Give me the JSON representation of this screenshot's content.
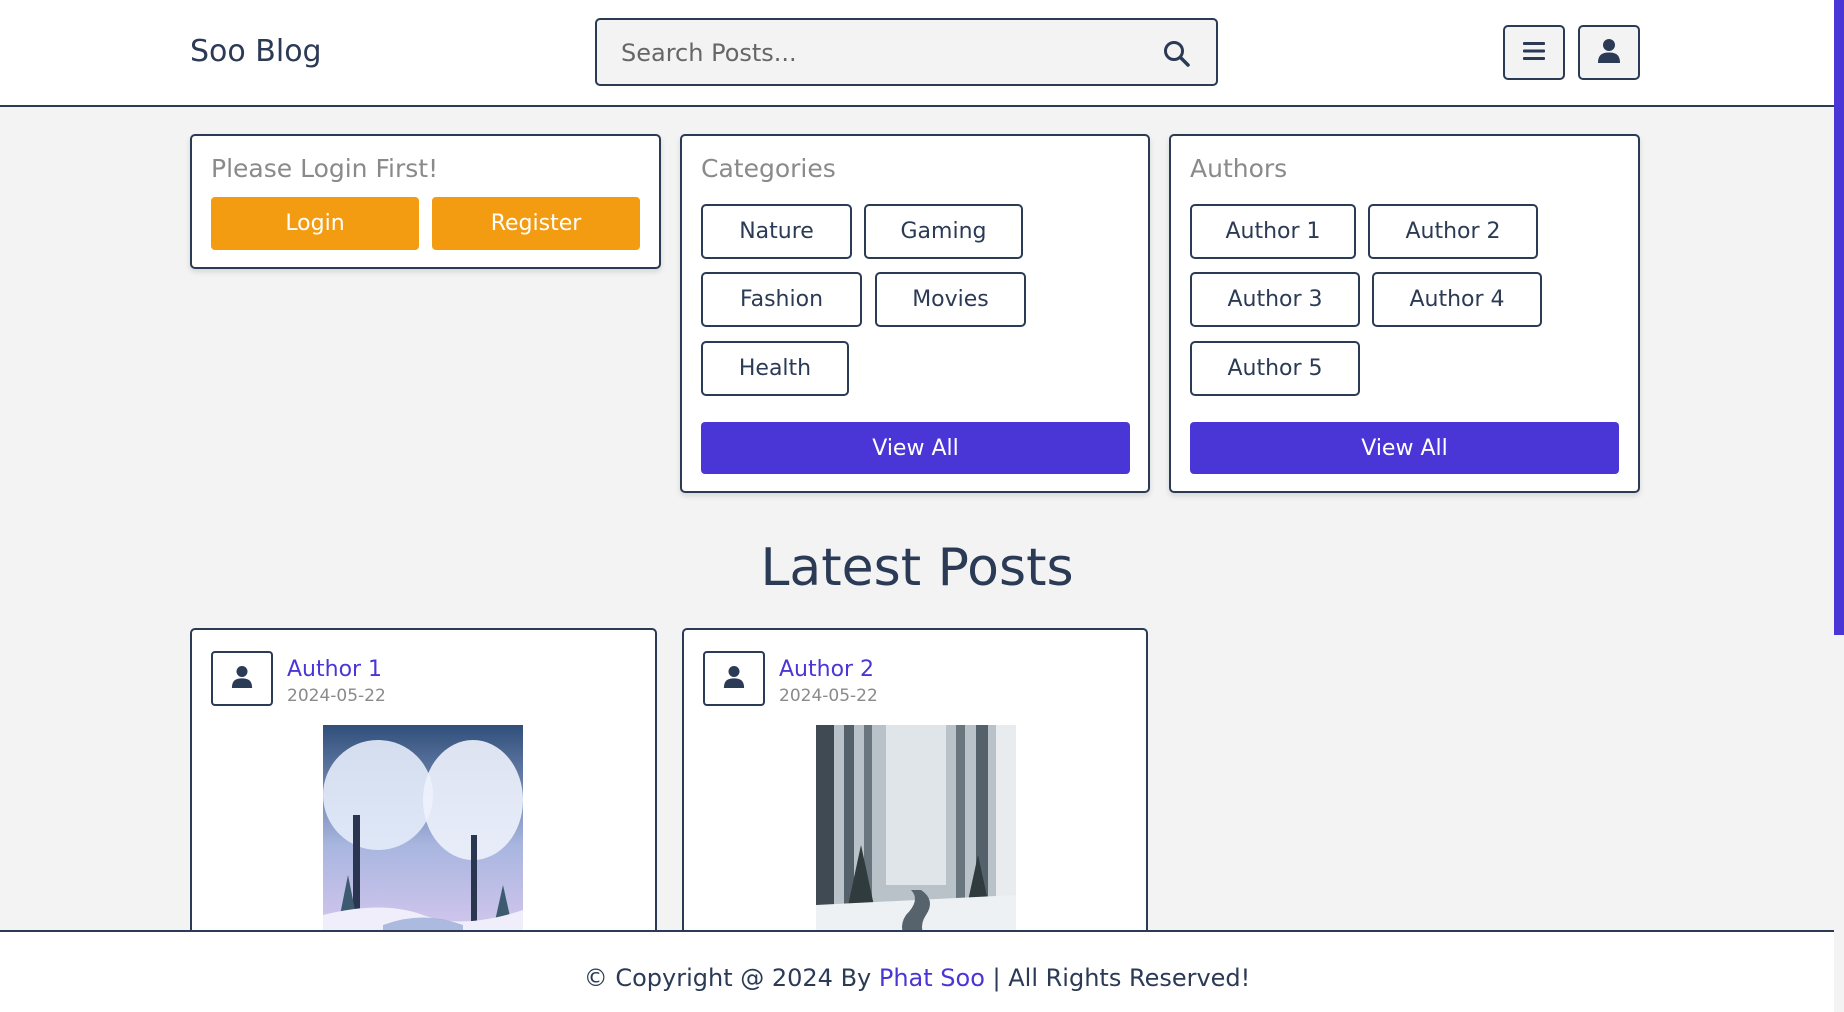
{
  "header": {
    "logo": "Soo Blog",
    "search_placeholder": "Search Posts...",
    "menu_icon": "hamburger-menu-icon",
    "user_icon": "user-icon"
  },
  "login_box": {
    "title": "Please Login First!",
    "login_label": "Login",
    "register_label": "Register"
  },
  "categories": {
    "title": "Categories",
    "items": [
      "Nature",
      "Gaming",
      "Fashion",
      "Movies",
      "Health"
    ],
    "view_all": "View All"
  },
  "authors": {
    "title": "Authors",
    "items": [
      "Author 1",
      "Author 2",
      "Author 3",
      "Author 4",
      "Author 5"
    ],
    "view_all": "View All"
  },
  "latest": {
    "title": "Latest Posts",
    "posts": [
      {
        "author": "Author 1",
        "date": "2024-05-22"
      },
      {
        "author": "Author 2",
        "date": "2024-05-22"
      }
    ]
  },
  "footer": {
    "prefix": "© Copyright @ 2024 By ",
    "link": "Phat Soo",
    "suffix": " | All Rights Reserved!"
  },
  "colors": {
    "accent": "#4a35d6",
    "orange": "#f39c12",
    "text": "#2b3a55",
    "background": "#f3f3f3"
  }
}
